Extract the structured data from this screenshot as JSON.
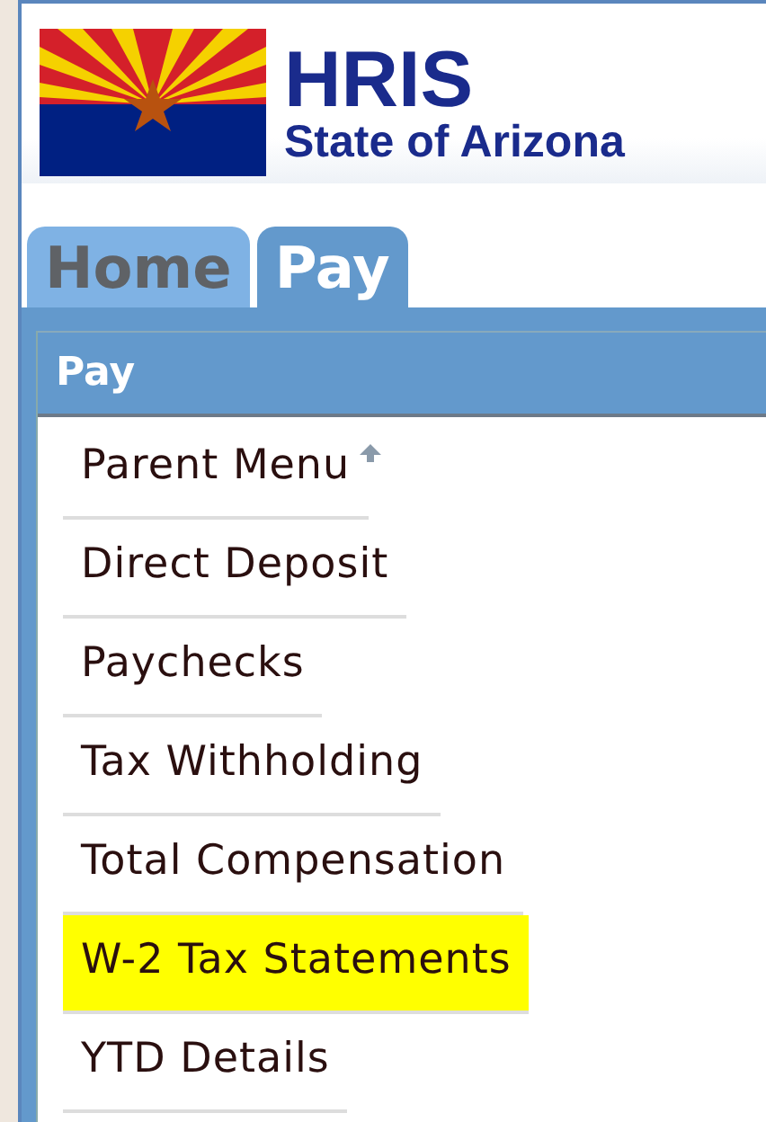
{
  "logo": {
    "title": "HRIS",
    "subtitle": "State of Arizona"
  },
  "tabs": [
    {
      "label": "Home",
      "selected": false
    },
    {
      "label": "Pay",
      "selected": true
    }
  ],
  "panel": {
    "title": "Pay"
  },
  "menu": [
    {
      "label": "Parent Menu",
      "kind": "parent",
      "highlighted": false
    },
    {
      "label": "Direct Deposit",
      "kind": "link",
      "highlighted": false
    },
    {
      "label": "Paychecks",
      "kind": "link",
      "highlighted": false
    },
    {
      "label": "Tax Withholding",
      "kind": "link",
      "highlighted": false
    },
    {
      "label": "Total Compensation",
      "kind": "link",
      "highlighted": false
    },
    {
      "label": "W-2 Tax Statements",
      "kind": "link",
      "highlighted": true
    },
    {
      "label": "YTD Details",
      "kind": "link",
      "highlighted": false
    }
  ]
}
